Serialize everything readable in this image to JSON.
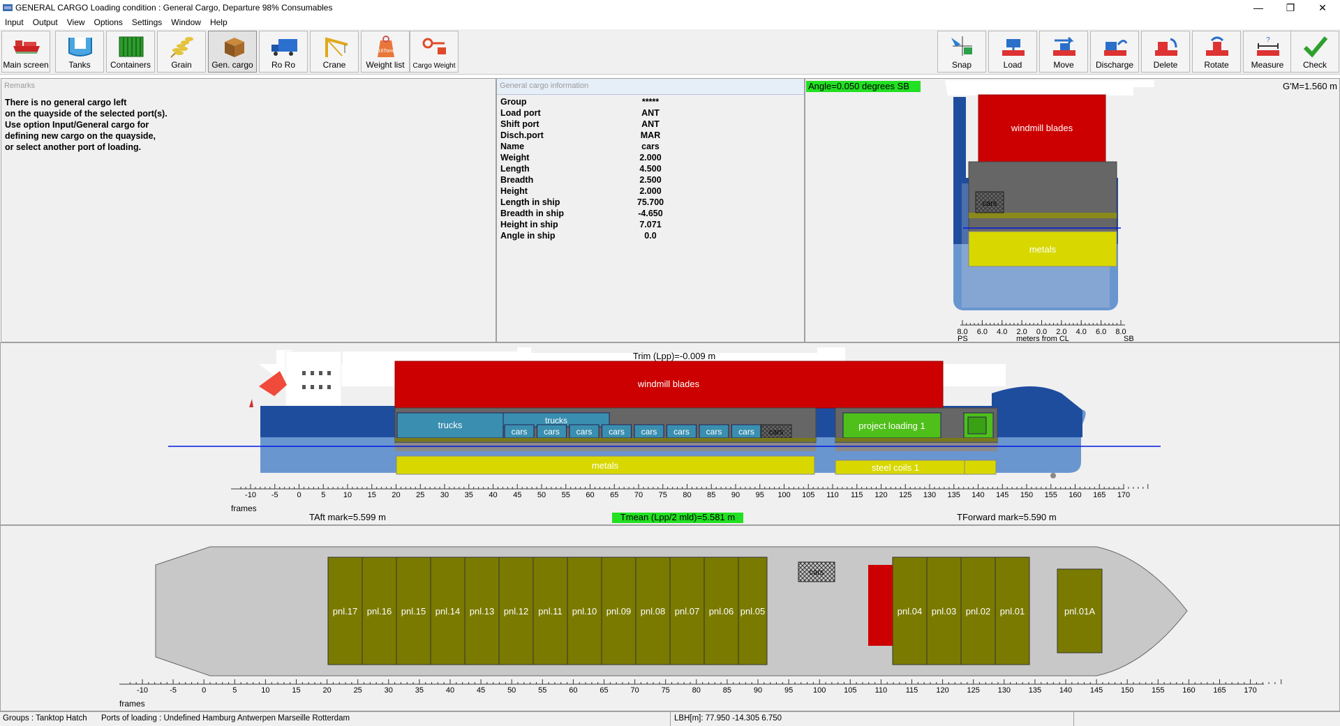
{
  "window": {
    "title": "GENERAL CARGO  Loading condition : General Cargo, Departure 98% Consumables",
    "minimize": "—",
    "maximize": "❐",
    "close": "✕"
  },
  "menu": [
    "Input",
    "Output",
    "View",
    "Options",
    "Settings",
    "Window",
    "Help"
  ],
  "toolbar": {
    "left": [
      {
        "label": "Main screen",
        "icon": "ship-icon"
      },
      {
        "label": "Tanks",
        "icon": "tanks-icon"
      },
      {
        "label": "Containers",
        "icon": "container-icon"
      },
      {
        "label": "Grain",
        "icon": "grain-icon"
      },
      {
        "label": "Gen. cargo",
        "icon": "cargo-box-icon",
        "selected": true
      },
      {
        "label": "Ro Ro",
        "icon": "truck-icon"
      },
      {
        "label": "Crane",
        "icon": "crane-icon"
      },
      {
        "label": "Weight list",
        "icon": "weight-icon",
        "icon_text": "16Tons"
      },
      {
        "label": "Cargo Weight",
        "icon": "cargo-weight-icon"
      }
    ],
    "right": [
      {
        "label": "Snap",
        "icon": "snap-icon"
      },
      {
        "label": "Load",
        "icon": "load-icon"
      },
      {
        "label": "Move",
        "icon": "move-icon"
      },
      {
        "label": "Discharge",
        "icon": "discharge-icon"
      },
      {
        "label": "Delete",
        "icon": "delete-icon"
      },
      {
        "label": "Rotate",
        "icon": "rotate-icon"
      },
      {
        "label": "Measure",
        "icon": "measure-icon",
        "icon_text": "?"
      },
      {
        "label": "Check",
        "icon": "check-icon"
      }
    ]
  },
  "remarks": {
    "header": "Remarks",
    "text": "There is no general cargo left\non the quayside of the selected port(s).\nUse option Input/General cargo for\ndefining new cargo on the quayside,\nor select another port of loading."
  },
  "cargo_info": {
    "header": "General cargo information",
    "rows": [
      {
        "key": "Group",
        "value": "*****"
      },
      {
        "key": "Load port",
        "value": "ANT"
      },
      {
        "key": "Shift port",
        "value": "ANT"
      },
      {
        "key": "Disch.port",
        "value": "MAR"
      },
      {
        "key": "Name",
        "value": "cars"
      },
      {
        "key": "Weight",
        "value": "2.000"
      },
      {
        "key": "Length",
        "value": "4.500"
      },
      {
        "key": "Breadth",
        "value": "2.500"
      },
      {
        "key": "Height",
        "value": "2.000"
      },
      {
        "key": "Length in ship",
        "value": "75.700"
      },
      {
        "key": "Breadth in ship",
        "value": "-4.650"
      },
      {
        "key": "Height in ship",
        "value": "7.071"
      },
      {
        "key": "Angle in ship",
        "value": "0.0"
      }
    ]
  },
  "cross_section": {
    "angle": "Angle=0.050 degrees SB",
    "gm": "G'M=1.560 m",
    "cargo": {
      "windmill": "windmill blades",
      "cars": "cars",
      "metals": "metals"
    },
    "scale_ticks": [
      "8.0",
      "6.0",
      "4.0",
      "2.0",
      "0.0",
      "2.0",
      "4.0",
      "6.0",
      "8.0"
    ],
    "ps": "PS",
    "sb": "SB",
    "axis_label": "meters from CL"
  },
  "profile": {
    "trim": "Trim (Lpp)=-0.009 m",
    "windmill": "windmill blades",
    "trucks": "trucks",
    "trucks2": "trucks",
    "cars": [
      "cars",
      "cars",
      "cars",
      "cars",
      "cars",
      "cars",
      "cars",
      "cars"
    ],
    "cars_hatched": "cars",
    "project": "project loading 1",
    "metals": "metals",
    "steel": "steel coils 1",
    "frames_label": "frames",
    "taft": "TAft mark=5.599 m",
    "tmean": "Tmean (Lpp/2 mld)=5.581 m",
    "tfwd": "TForward mark=5.590 m",
    "ticks": [
      "-10",
      "-5",
      "0",
      "5",
      "10",
      "15",
      "20",
      "25",
      "30",
      "35",
      "40",
      "45",
      "50",
      "55",
      "60",
      "65",
      "70",
      "75",
      "80",
      "85",
      "90",
      "95",
      "100",
      "105",
      "110",
      "115",
      "120",
      "125",
      "130",
      "135",
      "140",
      "145",
      "150",
      "155",
      "160",
      "165",
      "170"
    ]
  },
  "plan": {
    "panels": [
      "pnl.17",
      "pnl.16",
      "pnl.15",
      "pnl.14",
      "pnl.13",
      "pnl.12",
      "pnl.11",
      "pnl.10",
      "pnl.09",
      "pnl.08",
      "pnl.07",
      "pnl.06",
      "pnl.05",
      "pnl.04",
      "pnl.03",
      "pnl.02",
      "pnl.01",
      "pnl.01A"
    ],
    "cars": "cars",
    "frames_label": "frames",
    "ticks": [
      "-10",
      "-5",
      "0",
      "5",
      "10",
      "15",
      "20",
      "25",
      "30",
      "35",
      "40",
      "45",
      "50",
      "55",
      "60",
      "65",
      "70",
      "75",
      "80",
      "85",
      "90",
      "95",
      "100",
      "105",
      "110",
      "115",
      "120",
      "125",
      "130",
      "135",
      "140",
      "145",
      "150",
      "155",
      "160",
      "165",
      "170"
    ]
  },
  "status": {
    "groups": "Groups :  Tanktop Hatch",
    "ports": "Ports of loading :  Undefined Hamburg Antwerpen Marseille Rotterdam",
    "lbh": "LBH[m]: 77.950   -14.305   6.750"
  }
}
